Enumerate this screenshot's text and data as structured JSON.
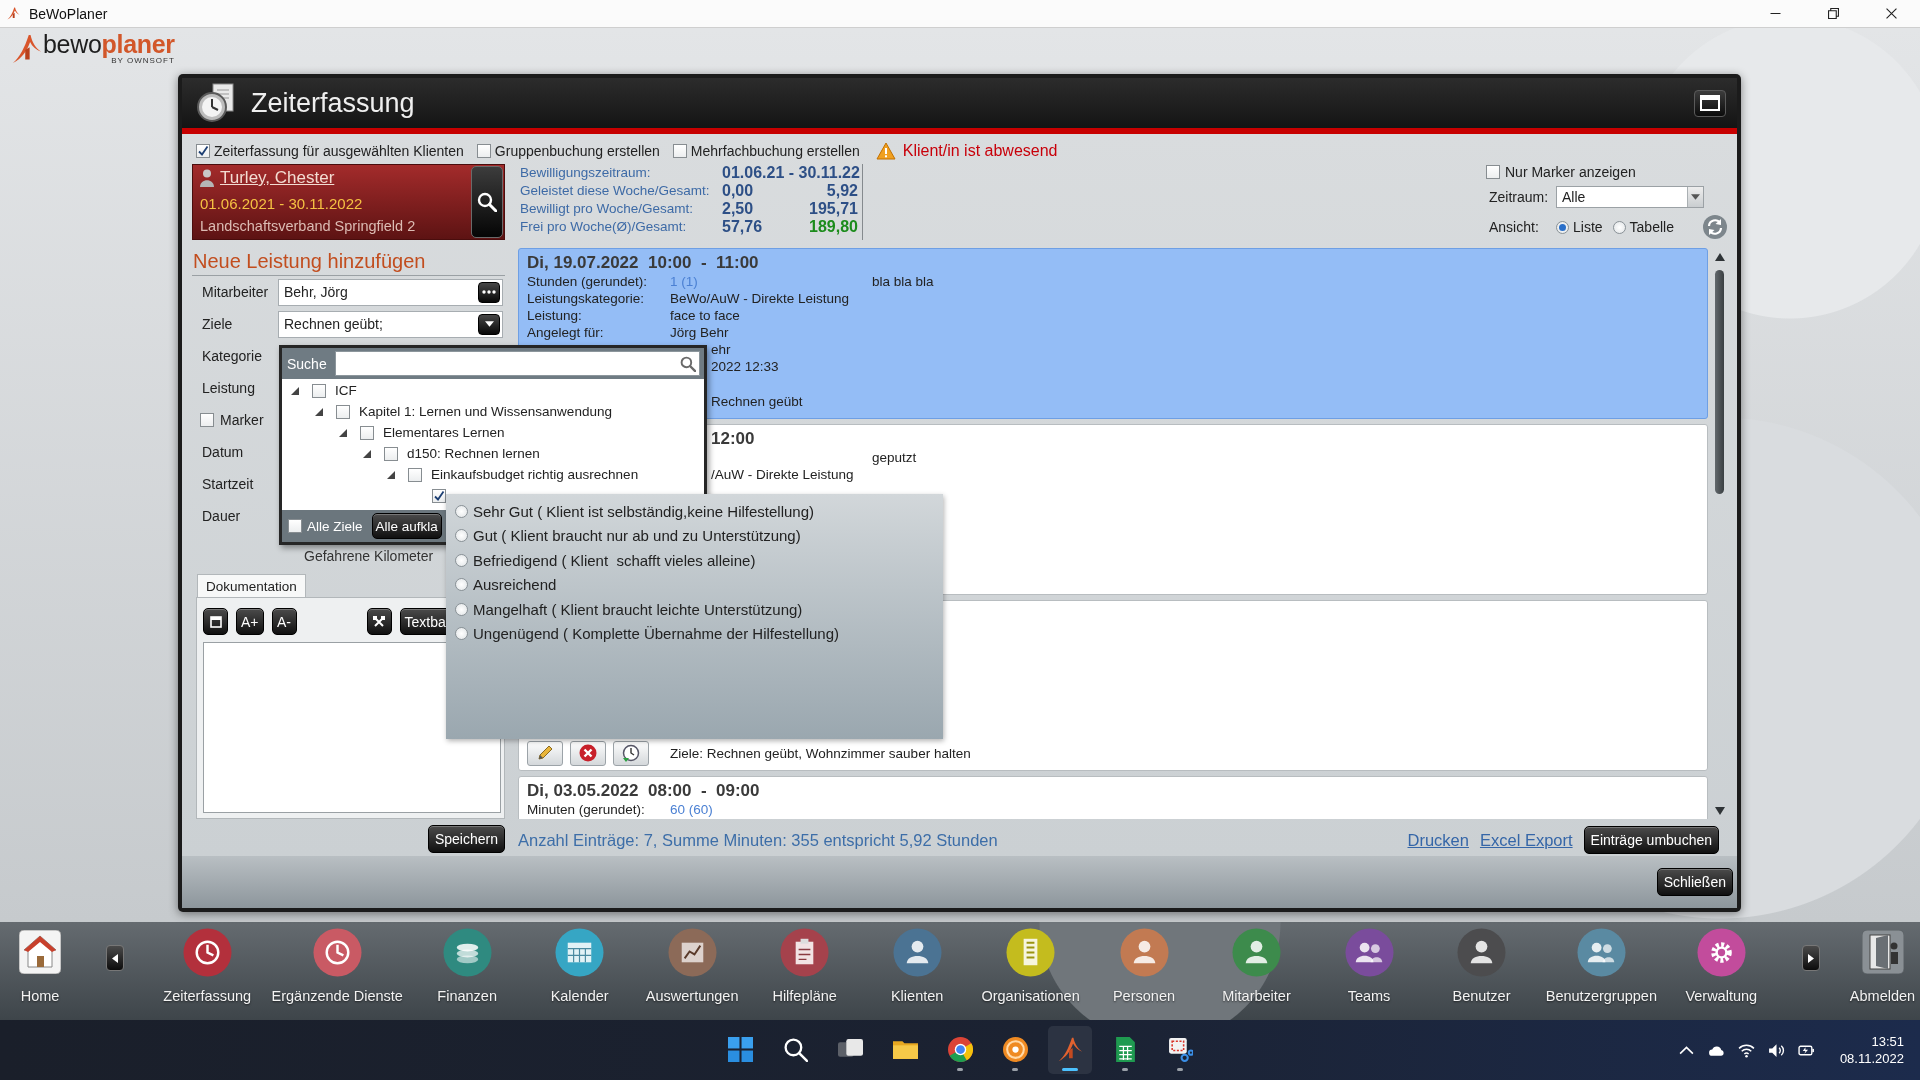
{
  "window": {
    "title": "BeWoPlaner"
  },
  "logo": {
    "words": [
      "bewo",
      "planer"
    ],
    "tagline": "BY OWNSOFT"
  },
  "dialog": {
    "title": "Zeiterfassung",
    "options": [
      {
        "label": "Zeiterfassung für ausgewählten Klienten",
        "checked": true
      },
      {
        "label": "Gruppenbuchung erstellen",
        "checked": false
      },
      {
        "label": "Mehrfachbuchung erstellen",
        "checked": false
      }
    ],
    "warning": "Klient/in ist abwesend",
    "client": {
      "name": "Turley, Chester",
      "period": "01.06.2021 - 30.11.2022",
      "payer": "Landschaftsverband Springfield 2"
    },
    "stats": [
      {
        "label": "Bewilligungszeitraum:",
        "value": "01.06.21 - 30.11.22",
        "highlighted": false
      },
      {
        "label": "Geleistet diese Woche/Gesamt:",
        "week": "0,00",
        "total": "5,92",
        "highlighted": false
      },
      {
        "label": "Bewilligt pro Woche/Gesamt:",
        "week": "2,50",
        "total": "195,71",
        "highlighted": false
      },
      {
        "label": "Frei pro Woche(Ø)/Gesamt:",
        "week": "57,76",
        "total": "189,80",
        "highlighted": true
      }
    ],
    "filters": {
      "marker_only": {
        "label": "Nur Marker anzeigen",
        "checked": false
      },
      "period": {
        "label": "Zeitraum:",
        "value": "Alle"
      },
      "view": {
        "label": "Ansicht:",
        "options": [
          {
            "label": "Liste",
            "selected": true
          },
          {
            "label": "Tabelle",
            "selected": false
          }
        ]
      }
    },
    "form": {
      "heading": "Neue Leistung hinzufügen",
      "fields": [
        {
          "label": "Mitarbeiter",
          "kind": "picker",
          "value": "Behr, Jörg"
        },
        {
          "label": "Ziele",
          "kind": "dropdown",
          "value": "Rechnen geübt;"
        },
        {
          "label": "Kategorie",
          "kind": "label"
        },
        {
          "label": "Leistung",
          "kind": "label"
        },
        {
          "label": "Marker",
          "kind": "checkbox",
          "checked": false
        },
        {
          "label": "Datum",
          "kind": "label"
        },
        {
          "label": "Startzeit",
          "kind": "label"
        },
        {
          "label": "Dauer",
          "kind": "label"
        }
      ],
      "distance_label": "Gefahrene Kilometer",
      "tabs": [
        {
          "label": "Dokumentation",
          "selected": true
        }
      ],
      "toolbar": [
        {
          "kind": "square"
        },
        {
          "kind": "text",
          "label": "A+"
        },
        {
          "kind": "text",
          "label": "A-"
        },
        {
          "kind": "tools"
        },
        {
          "kind": "text",
          "label": "Textba"
        }
      ],
      "save_button": "Speichern"
    },
    "entries": [
      {
        "selected": true,
        "header": "Di, 19.07.2022  10:00  -  11:00",
        "rows": [
          {
            "kind": "field",
            "label": "Stunden (gerundet):",
            "value": "1 (1)",
            "note": "bla bla bla"
          },
          {
            "kind": "field",
            "label": "Leistungskategorie:",
            "value": "BeWo/AuW - Direkte Leistung"
          },
          {
            "kind": "field",
            "label": "Leistung:",
            "value": "face to face"
          },
          {
            "kind": "field",
            "label": "Angelegt für:",
            "value": "Jörg Behr"
          },
          {
            "kind": "clipped",
            "value": "ehr"
          },
          {
            "kind": "clipped",
            "value": "2022 12:33"
          }
        ],
        "goals_fragment": "Rechnen geübt"
      },
      {
        "selected": false,
        "header_fragment": "12:00",
        "rows": [
          {
            "kind": "field",
            "note": "geputzt"
          },
          {
            "kind": "clipped",
            "value": "/AuW - Direkte Leistung"
          }
        ]
      },
      {
        "selected": false,
        "goals": "Ziele: Rechnen geübt, Wohnzimmer sauber halten"
      },
      {
        "selected": false,
        "header": "Di, 03.05.2022  08:00  -  09:00",
        "rows": [
          {
            "kind": "field",
            "label": "Minuten (gerundet):",
            "value": "60 (60)"
          }
        ]
      }
    ],
    "status": "Anzahl Einträge: 7, Summe Minuten: 355 entspricht 5,92 Stunden",
    "links": [
      "Drucken",
      "Excel Export"
    ],
    "rebook_button": "Einträge umbuchen",
    "close_button": "Schließen",
    "goal_picker": {
      "search_label": "Suche",
      "tree": [
        {
          "label": "ICF",
          "checked": false,
          "expanded": true,
          "children": [
            {
              "label": "Kapitel 1: Lernen und Wissensanwendung",
              "checked": false,
              "expanded": true,
              "children": [
                {
                  "label": "Elementares Lernen",
                  "checked": false,
                  "expanded": true,
                  "children": [
                    {
                      "label": "d150: Rechnen lernen",
                      "checked": false,
                      "expanded": true,
                      "children": [
                        {
                          "label": "Einkaufsbudget richtig ausrechnen",
                          "checked": false,
                          "expanded": true,
                          "children": [
                            {
                              "checked": true,
                              "expanded": false
                            }
                          ]
                        }
                      ]
                    }
                  ]
                }
              ]
            }
          ]
        }
      ],
      "select_all": {
        "label": "Alle Ziele",
        "checked": false
      },
      "expand_button": "Alle aufkla"
    },
    "rating_options": [
      {
        "label": "Sehr Gut ( Klient ist selbständig,keine Hilfestellung)",
        "selected": false
      },
      {
        "label": "Gut ( Klient braucht nur ab und zu Unterstützung)",
        "selected": false
      },
      {
        "label": "Befriedigend ( Klient  schafft vieles alleine)",
        "selected": false
      },
      {
        "label": "Ausreichend",
        "selected": false
      },
      {
        "label": "Mangelhaft ( Klient braucht leichte Unterstützung)",
        "selected": false
      },
      {
        "label": "Ungenügend ( Komplette Übernahme der Hilfestellung)",
        "selected": false
      }
    ]
  },
  "dock": {
    "home": "Home",
    "items": [
      {
        "label": "Zeiterfassung",
        "kind": "clock",
        "color": "#b3303c"
      },
      {
        "label": "Ergänzende Dienste",
        "kind": "clock",
        "color": "#c95a64"
      },
      {
        "label": "Finanzen",
        "kind": "coins",
        "color": "#2f8a80"
      },
      {
        "label": "Kalender",
        "kind": "calendar",
        "color": "#36a6c4"
      },
      {
        "label": "Auswertungen",
        "kind": "chart",
        "color": "#8c6a58"
      },
      {
        "label": "Hilfepläne",
        "kind": "clipboard",
        "color": "#a5424c"
      },
      {
        "label": "Klienten",
        "kind": "person",
        "color": "#4b7393"
      },
      {
        "label": "Organisationen",
        "kind": "building",
        "color": "#c4bc1e"
      },
      {
        "label": "Personen",
        "kind": "person",
        "color": "#c27a52"
      },
      {
        "label": "Mitarbeiter",
        "kind": "person",
        "color": "#3d8b4c"
      },
      {
        "label": "Teams",
        "kind": "people",
        "color": "#7a4c9c"
      },
      {
        "label": "Benutzer",
        "kind": "person",
        "color": "#4c4c4e"
      },
      {
        "label": "Benutzergruppen",
        "kind": "people",
        "color": "#5a8aa2"
      },
      {
        "label": "Verwaltung",
        "kind": "gear",
        "color": "#c24c9c"
      }
    ],
    "logout": "Abmelden"
  },
  "taskbar": {
    "apps": [
      {
        "kind": "start",
        "selected": false,
        "running": false
      },
      {
        "kind": "search",
        "selected": false,
        "running": false
      },
      {
        "kind": "taskview",
        "selected": false,
        "running": false
      },
      {
        "kind": "folder",
        "selected": false,
        "running": false
      },
      {
        "kind": "browser",
        "selected": false,
        "running": true
      },
      {
        "kind": "ring",
        "selected": false,
        "running": true
      },
      {
        "kind": "swoosh",
        "selected": true,
        "running": true
      },
      {
        "kind": "spreadsheet",
        "selected": false,
        "running": true
      },
      {
        "kind": "snip",
        "selected": false,
        "running": true
      }
    ],
    "time": "13:51",
    "date": "08.11.2022"
  }
}
